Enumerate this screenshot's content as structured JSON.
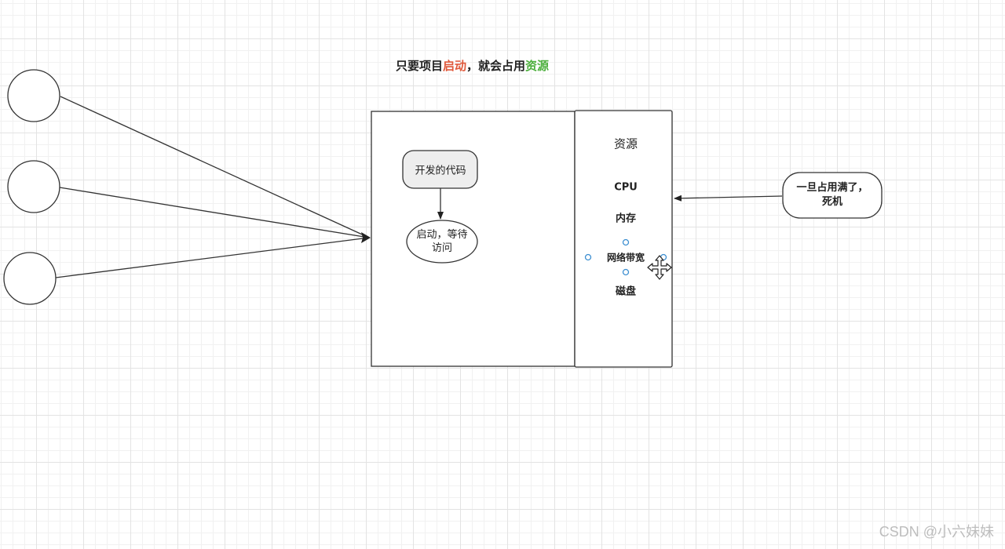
{
  "diagram": {
    "title": {
      "part1": "只要项目",
      "highlight1": "启动",
      "part2": "，就会占用",
      "highlight2": "资源"
    },
    "code_node": "开发的代码",
    "started_node": {
      "line1": "启动，等待",
      "line2": "访问"
    },
    "resources": {
      "title": "资源",
      "items": [
        "CPU",
        "内存",
        "网络带宽",
        "磁盘"
      ]
    },
    "note": {
      "line1": "一旦占用满了，",
      "line2": "死机"
    },
    "colors": {
      "highlight_start": "#e0593b",
      "highlight_resource": "#4caf3c",
      "handle": "#3d8fd1",
      "code_node_fill": "#eeeeee"
    }
  },
  "watermark": "CSDN @小六妹妹"
}
